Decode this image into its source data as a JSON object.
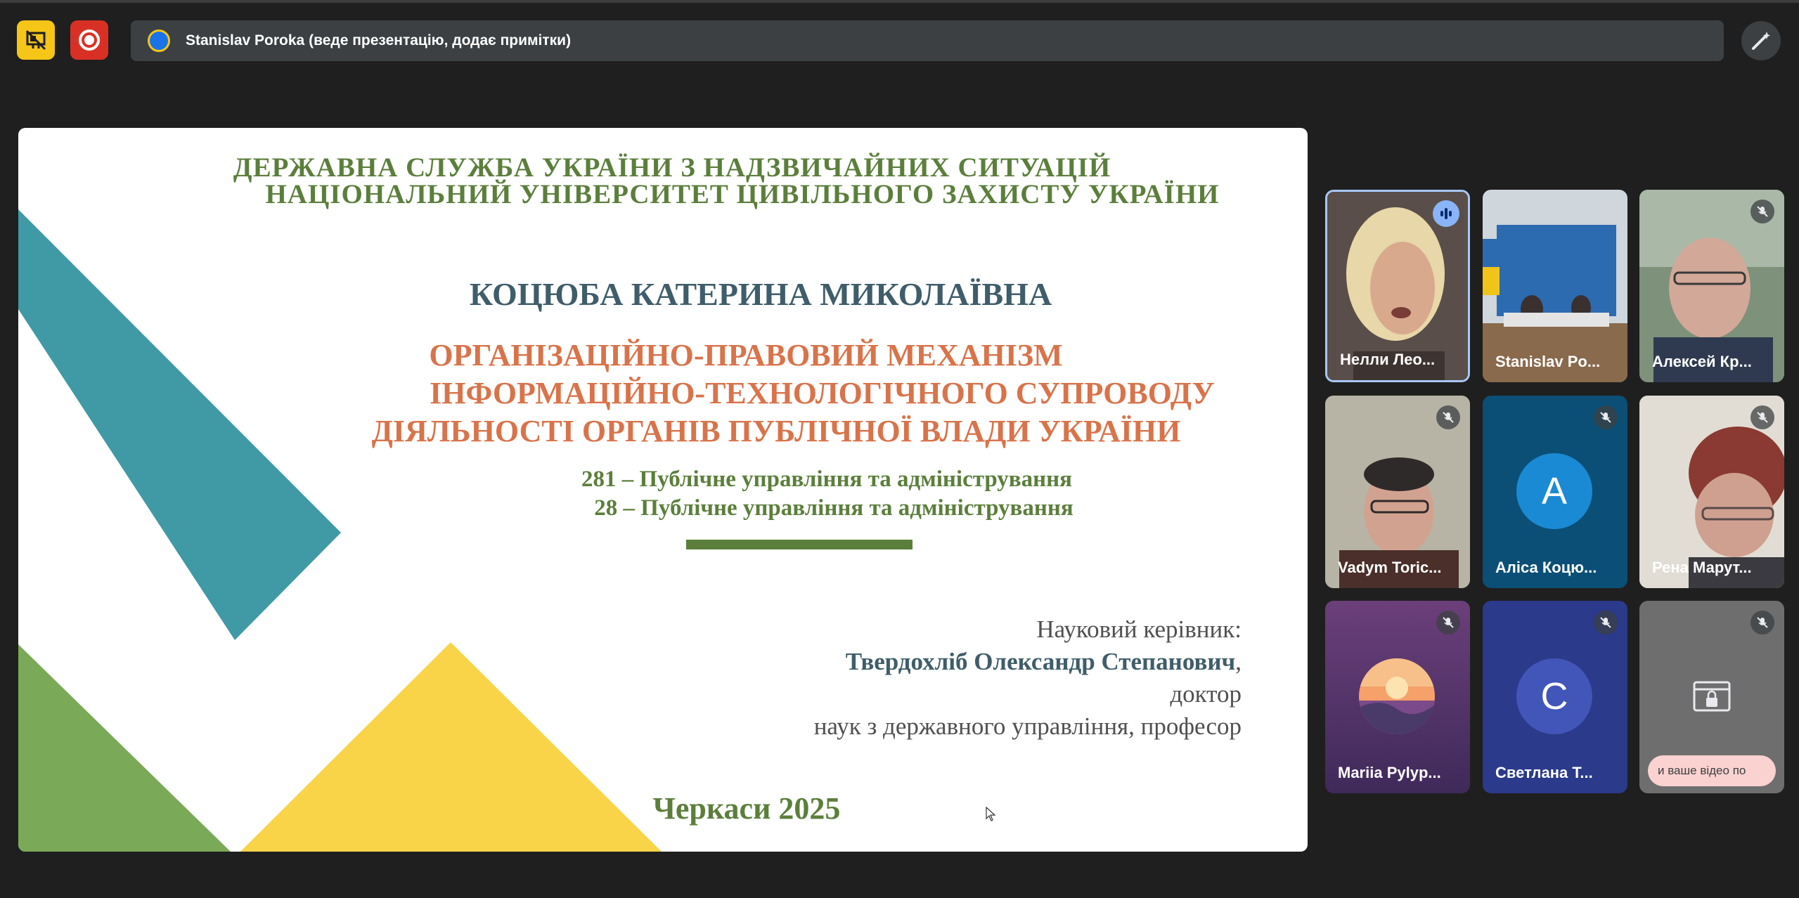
{
  "topbar": {
    "present_icon": "presentation-off-icon",
    "record_icon": "record-icon",
    "banner_text": "Stanislav Poroka (веде презентацію, додає примітки)",
    "annotate_icon": "pen-sparkle-icon"
  },
  "slide": {
    "org_line1": "ДЕРЖАВНА СЛУЖБА УКРАЇНИ З НАДЗВИЧАЙНИХ СИТУАЦІЙ",
    "org_line2": "НАЦІОНАЛЬНИЙ УНІВЕРСИТЕТ ЦИВІЛЬНОГО ЗАХИСТУ УКРАЇНИ",
    "author": "КОЦЮБА  КАТЕРИНА МИКОЛАЇВНА",
    "thesis_line1": "ОРГАНІЗАЦІЙНО-ПРАВОВИЙ МЕХАНІЗМ",
    "thesis_line2": "ІНФОРМАЦІЙНО-ТЕХНОЛОГІЧНОГО СУПРОВОДУ",
    "thesis_line3": "ДІЯЛЬНОСТІ ОРГАНІВ ПУБЛІЧНОЇ ВЛАДИ УКРАЇНИ",
    "specialty1": "281 – Публічне управління та адміністрування",
    "specialty2": "28 – Публічне управління та адміністрування",
    "supervisor_label": "Науковий керівник:",
    "supervisor_name": "Твердохліб Олександр Степанович",
    "supervisor_comma": ",",
    "supervisor_degree1": "доктор",
    "supervisor_degree2": "наук з державного управління, професор",
    "city_year": "Черкаси 2025",
    "colors": {
      "teal": "#3f9aa6",
      "green": "#7aa957",
      "yellow": "#f9d448",
      "orange": "#d9734a",
      "dark_green": "#5b7f3b"
    }
  },
  "participants": [
    {
      "name": "Нелли Лео...",
      "status": "speaking"
    },
    {
      "name": "Stanislav Po...",
      "status": "presenting"
    },
    {
      "name": "Алексей Кр...",
      "status": "muted"
    },
    {
      "name": "Vadym Toric...",
      "status": "muted"
    },
    {
      "name": "Аліса Коцю...",
      "status": "muted",
      "initial": "A"
    },
    {
      "name": "Рена Марут...",
      "status": "muted"
    },
    {
      "name": "Mariia Pylyp...",
      "status": "muted"
    },
    {
      "name": "Светлана Т...",
      "status": "muted",
      "initial": "C"
    },
    {
      "name": "",
      "status": "muted",
      "hint": "и ваше відео по"
    }
  ]
}
